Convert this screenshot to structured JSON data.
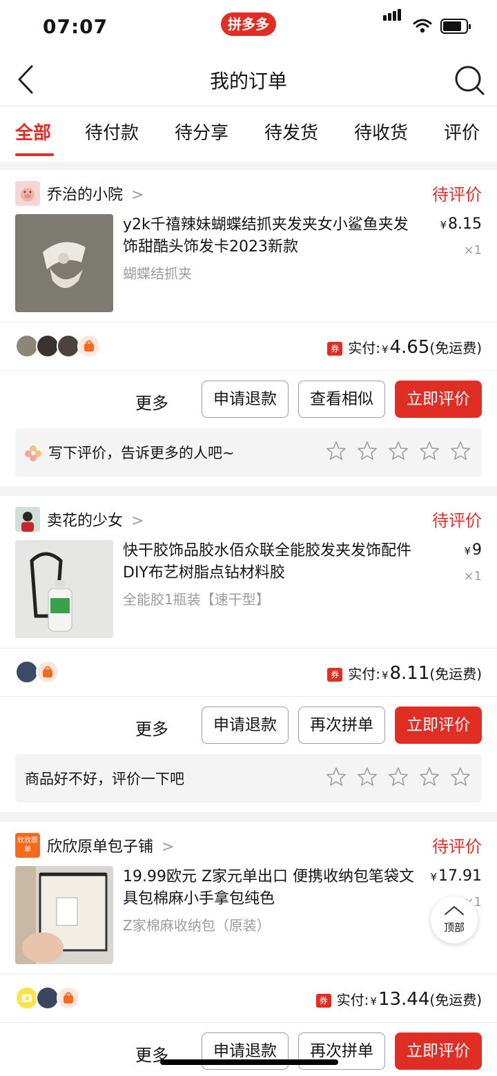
{
  "status_bar": {
    "time": "07:07",
    "app_badge": "拼多多"
  },
  "header": {
    "title": "我的订单"
  },
  "tabs": [
    "全部",
    "待付款",
    "待分享",
    "待发货",
    "待收货",
    "评价"
  ],
  "colors": {
    "accent": "#e02e24",
    "muted": "#9c9c9c"
  },
  "orders": [
    {
      "shop": "乔治的小院",
      "status": "待评价",
      "goods_name": "y2k千禧辣妹蝴蝶结抓夹发夹女小鲨鱼夹发饰甜酷头饰发卡2023新款",
      "spec": "蝴蝶结抓夹",
      "price_symbol": "¥",
      "price": "8.15",
      "qty": "×1",
      "coupon": "券",
      "paid_label": "实付:",
      "paid_symbol": "¥",
      "paid": "4.65",
      "shipping": "(免运费)",
      "more": "更多",
      "buttons": [
        "申请退款",
        "查看相似",
        "立即评价"
      ],
      "review_prompt": "写下评价，告诉更多的人吧~"
    },
    {
      "shop": "卖花的少女",
      "status": "待评价",
      "goods_name": "快干胶饰品胶水佰众联全能胶发夹发饰配件DIY布艺树脂点钻材料胶",
      "spec": "全能胶1瓶装【速干型】",
      "price_symbol": "¥",
      "price": "9",
      "qty": "×1",
      "coupon": "券",
      "paid_label": "实付:",
      "paid_symbol": "¥",
      "paid": "8.11",
      "shipping": "(免运费)",
      "more": "更多",
      "buttons": [
        "申请退款",
        "再次拼单",
        "立即评价"
      ],
      "review_prompt": "商品好不好，评价一下吧"
    },
    {
      "shop": "欣欣原单包子铺",
      "shop_logo_text": "欣欣原单",
      "status": "待评价",
      "goods_name": "19.99欧元 Z家元单出口 便携收纳包笔袋文具包棉麻小手拿包纯色",
      "spec": "Z家棉麻收纳包（原装）",
      "price_symbol": "¥",
      "price": "17.91",
      "qty": "×1",
      "coupon": "券",
      "paid_label": "实付:",
      "paid_symbol": "¥",
      "paid": "13.44",
      "shipping": "(免运费)",
      "more": "更多",
      "buttons": [
        "申请退款",
        "再次拼单",
        "立即评价"
      ]
    }
  ],
  "top_button": {
    "label": "顶部"
  }
}
